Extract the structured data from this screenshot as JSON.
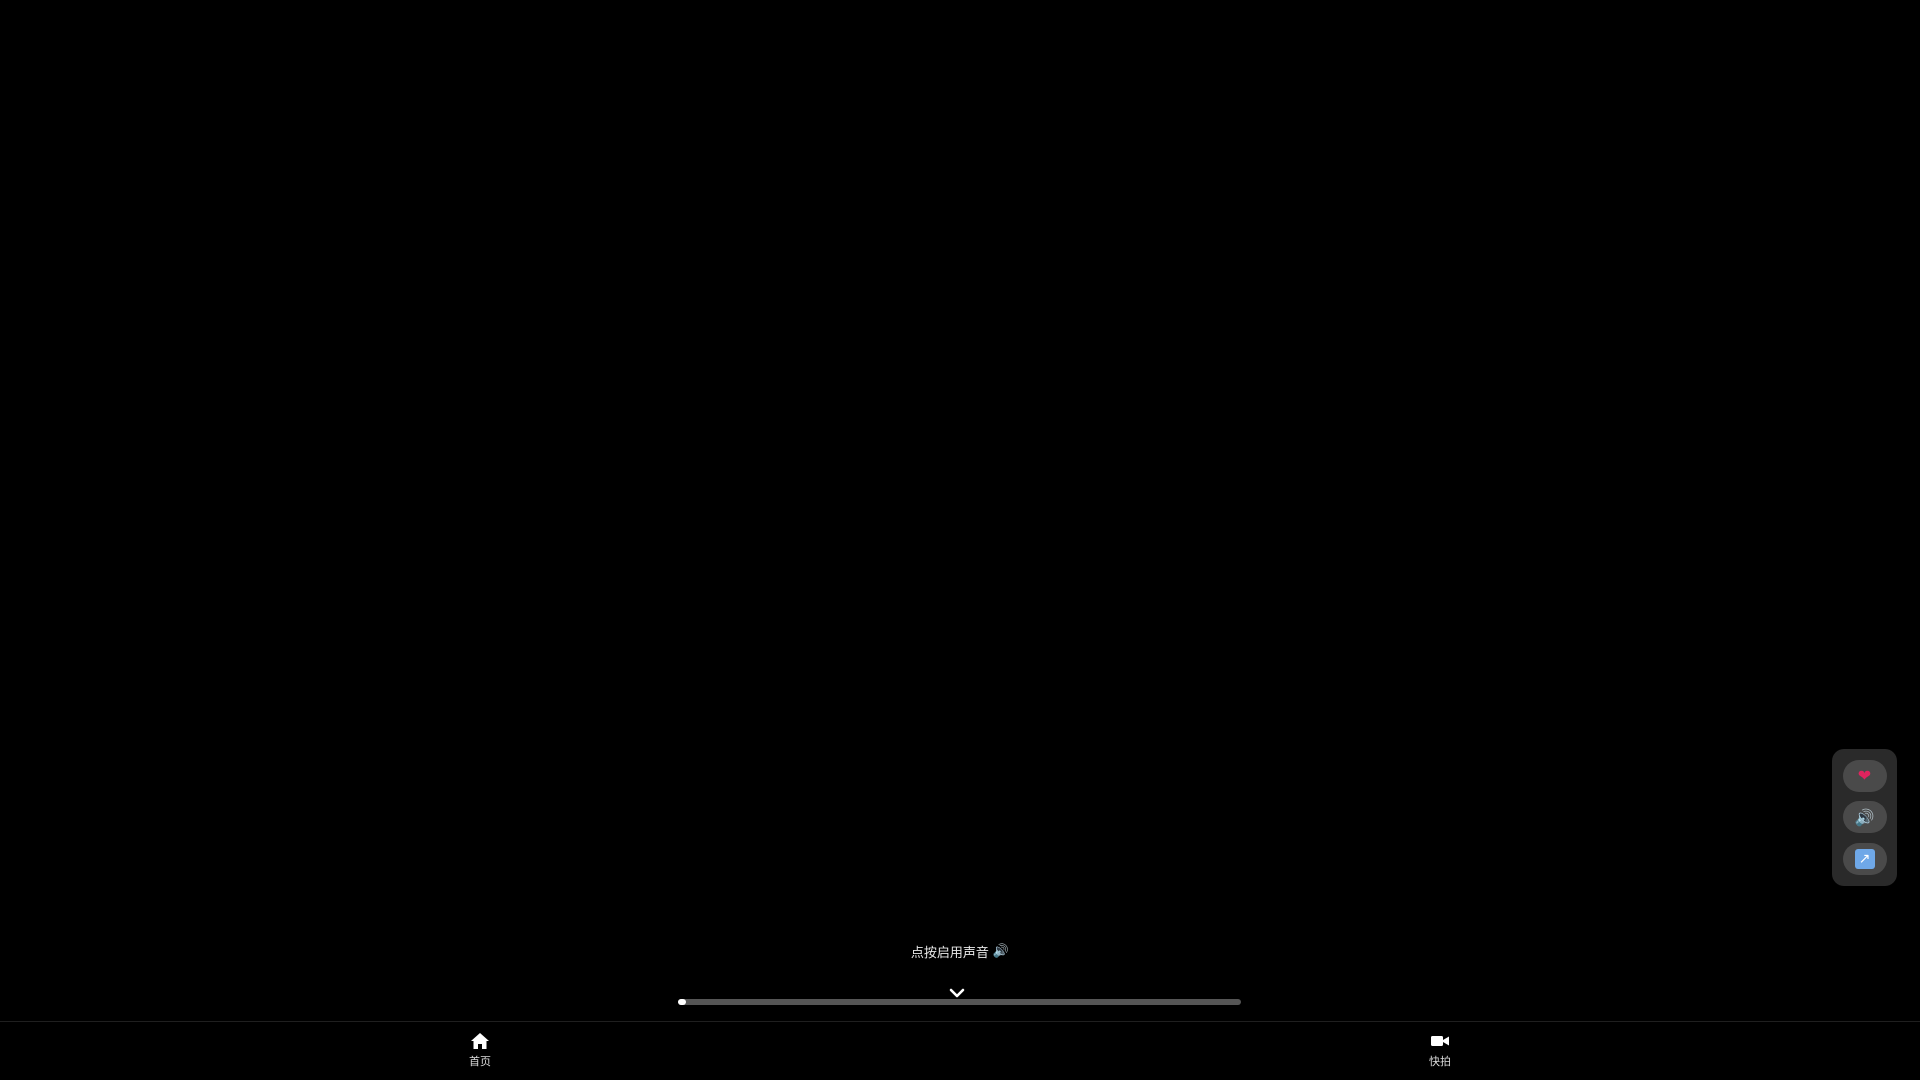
{
  "player": {
    "unmute_hint": "点按启用声音",
    "unmute_icon": "🔊",
    "progress": 0.012
  },
  "side_actions": {
    "like_icon": "❤",
    "sound_icon": "🔊",
    "share_icon": "↗"
  },
  "nav": {
    "items": [
      {
        "label": "首页",
        "icon": "home-icon"
      },
      {
        "label": "快拍",
        "icon": "video-camera-icon"
      }
    ]
  },
  "colors": {
    "background": "#000000",
    "panel": "#2a2a2a",
    "button": "#4a4a4a",
    "progress_track": "#555555",
    "progress_fill": "#ffffff"
  }
}
